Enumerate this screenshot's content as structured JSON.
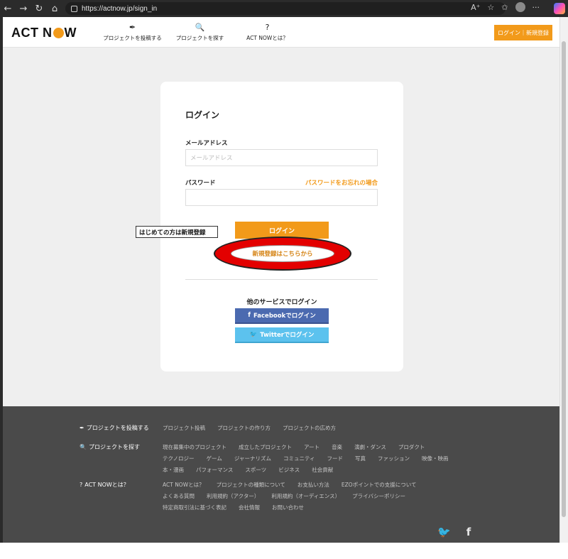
{
  "browser": {
    "url": "https://actnow.jp/sign_in",
    "back": "←",
    "forward": "→",
    "reload": "↻",
    "home": "⌂",
    "read_aloud": "A⁺",
    "favorite": "☆",
    "favorites": "✩",
    "more": "···"
  },
  "header": {
    "logo_left": "ACT N",
    "logo_right": "W",
    "nav": [
      {
        "icon": "✒",
        "label": "プロジェクトを投稿する"
      },
      {
        "icon": "🔍",
        "label": "プロジェクトを探す"
      },
      {
        "icon": "?",
        "label": "ACT NOWとは？"
      }
    ],
    "auth_button": "ログイン｜新規登録"
  },
  "login": {
    "title": "ログイン",
    "email_label": "メールアドレス",
    "email_placeholder": "メールアドレス",
    "password_label": "パスワード",
    "forgot_link": "パスワードをお忘れの場合",
    "login_button": "ログイン",
    "register_button": "新規登録はこちらから",
    "other_services": "他のサービスでログイン",
    "facebook_button": "Facebookでログイン",
    "twitter_button": "Twitterでログイン",
    "facebook_icon": "f",
    "twitter_icon": "🐦"
  },
  "annotation": {
    "text": "はじめての方は新規登録",
    "highlight_color": "#e30000"
  },
  "footer": {
    "post": {
      "icon": "✒",
      "heading": "プロジェクトを投稿する",
      "links": [
        "プロジェクト投稿",
        "プロジェクトの作り方",
        "プロジェクトの広め方"
      ]
    },
    "search": {
      "icon": "🔍",
      "heading": "プロジェクトを探す",
      "links": [
        "現在募集中のプロジェクト",
        "成立したプロジェクト",
        "アート",
        "音楽",
        "演劇・ダンス",
        "プロダクト",
        "テクノロジー",
        "ゲーム",
        "ジャーナリズム",
        "コミュニティ",
        "フード",
        "写真",
        "ファッション",
        "映像・映画",
        "本・漫画",
        "パフォーマンス",
        "スポーツ",
        "ビジネス",
        "社会貢献"
      ]
    },
    "about": {
      "icon": "?",
      "heading": "ACT NOWとは？",
      "links": [
        "ACT NOWとは？",
        "プロジェクトの種類について",
        "お支払い方法",
        "EZOポイントでの支援について",
        "よくある質問",
        "利用規約（アクター）",
        "利用規約（オーディエンス）",
        "プライバシーポリシー",
        "特定商取引法に基づく表記",
        "会社情報",
        "お問い合わせ"
      ]
    },
    "social": {
      "twitter": "🐦",
      "facebook": "f"
    }
  },
  "colors": {
    "accent": "#f29a1a",
    "facebook": "#4b6ab0",
    "twitter": "#5cc2ee",
    "footer_bg": "#4a4a4a"
  }
}
